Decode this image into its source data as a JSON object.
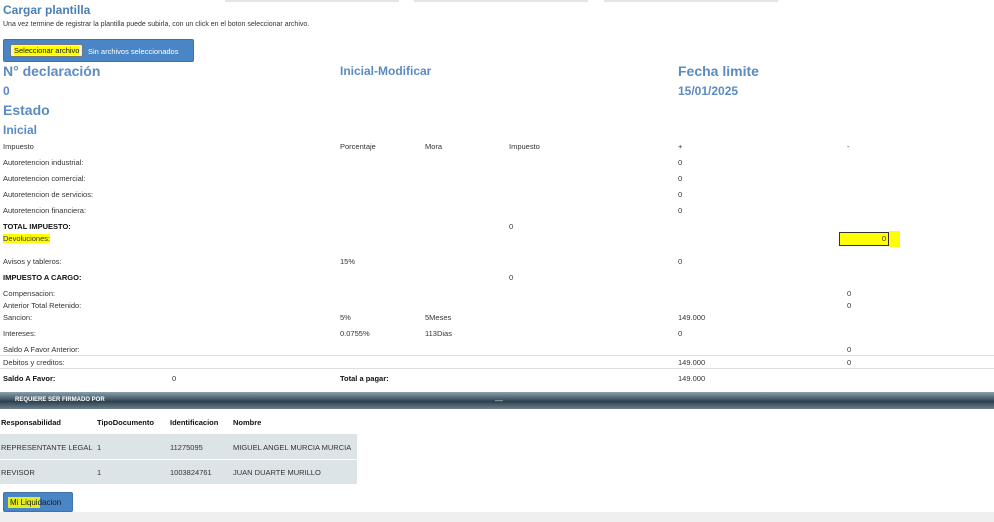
{
  "header": {
    "title": "Cargar plantilla",
    "instruction": "Una vez termine de registrar la plantilla puede subirla, con un click en el boton seleccionar archivo.",
    "file_button_label": "Seleccionar archivo",
    "file_status": "Sin archivos seleccionados"
  },
  "declaration": {
    "number_label": "N° declaración",
    "number_value": "0",
    "type_label": "Inicial-Modificar",
    "deadline_label": "Fecha limite",
    "deadline_value": "15/01/2025",
    "state_label": "Estado",
    "state_value": "Inicial"
  },
  "columns": {
    "impuesto": "Impuesto",
    "porcentaje": "Porcentaje",
    "mora": "Mora",
    "impuesto2": "Impuesto",
    "plus": "+",
    "minus": "-"
  },
  "rows": {
    "industrial": {
      "label": "Autoretencion industrial:",
      "plus": "0"
    },
    "comercial": {
      "label": "Autoretencion comercial:",
      "plus": "0"
    },
    "servicios": {
      "label": "Autoretencion de servicios:",
      "plus": "0"
    },
    "financiera": {
      "label": "Autoretencion financiera:",
      "plus": "0"
    },
    "total_impuesto": {
      "label": "TOTAL IMPUESTO:",
      "impuesto": "0"
    },
    "devoluciones": {
      "label": "Devoluciones:",
      "input_value": "0"
    },
    "avisos": {
      "label": "Avisos y tableros:",
      "porcentaje": "15%",
      "plus": "0"
    },
    "impuesto_cargo": {
      "label": "IMPUESTO A CARGO:",
      "impuesto": "0"
    },
    "compensacion": {
      "label": "Compensacion:",
      "minus": "0"
    },
    "anterior_retenido": {
      "label": "Anterior Total Retenido:",
      "minus": "0"
    },
    "sancion": {
      "label": "Sancion:",
      "porcentaje": "5%",
      "mora": "5Meses",
      "plus": "149.000"
    },
    "intereses": {
      "label": "Intereses:",
      "porcentaje": "0.0755%",
      "mora": "113Dias",
      "plus": "0"
    },
    "saldo_favor_anterior": {
      "label": "Saldo A Favor Anterior:",
      "minus": "0"
    },
    "debitos_creditos": {
      "label": "Debitos y creditos:",
      "plus": "149.000",
      "minus": "0"
    },
    "saldo_favor": {
      "label": "Saldo A Favor:",
      "value": "0"
    },
    "total_pagar": {
      "label": "Total a pagar:",
      "plus": "149.000"
    }
  },
  "signature": {
    "bar_title": "REQUIERE SER FIRMADO POR",
    "headers": [
      "Responsabilidad",
      "TipoDocumento",
      "Identificacion",
      "Nombre"
    ],
    "rows": [
      {
        "responsabilidad": "REPRESENTANTE LEGAL",
        "tipo": "1",
        "identificacion": "11275095",
        "nombre": "MIGUEL ANGEL MURCIA MURCIA"
      },
      {
        "responsabilidad": "REVISOR",
        "tipo": "1",
        "identificacion": "1003824761",
        "nombre": "JUAN DUARTE MURILLO"
      }
    ]
  },
  "footer": {
    "liquidacion_button": "Mi Liquidacion"
  },
  "colors": {
    "accent": "#4a86c5",
    "heading": "#5b8bc0",
    "highlight": "#ffff00"
  }
}
